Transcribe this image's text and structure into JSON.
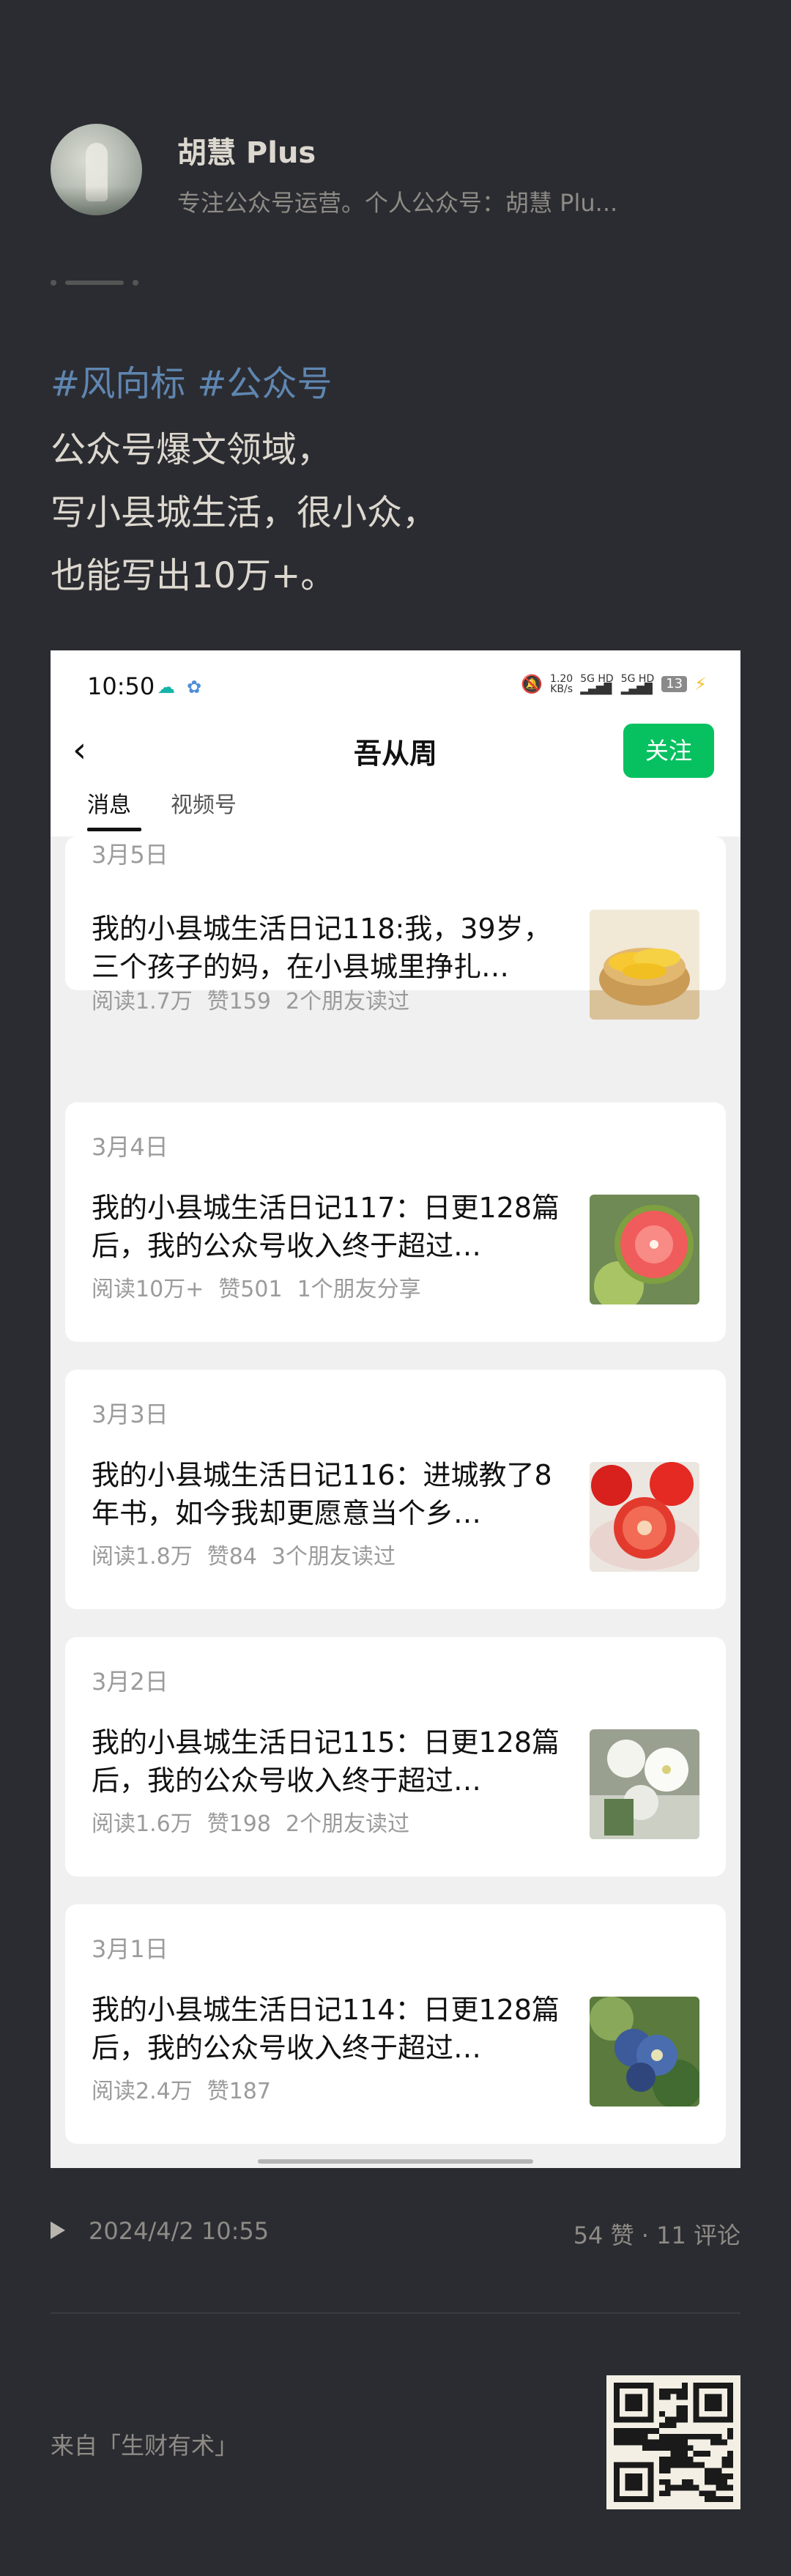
{
  "author": {
    "name": "胡慧 Plus",
    "description": "专注公众号运营。个人公众号：胡慧 Plu..."
  },
  "post": {
    "tags": [
      "#风向标",
      "#公众号"
    ],
    "lines": [
      "公众号爆文领域，",
      "写小县城生活，很小众，",
      "也能写出10万+。"
    ]
  },
  "screenshot": {
    "statusbar": {
      "time": "10:50",
      "net_speed_value": "1.20",
      "net_speed_unit": "KB/s",
      "sim1": "5G HD",
      "sim2": "5G HD",
      "battery": "13"
    },
    "nav": {
      "title": "吾从周",
      "follow_label": "关注"
    },
    "tabs": [
      "消息",
      "视频号"
    ],
    "articles": [
      {
        "date": "3月5日",
        "title": "我的小县城生活日记118:我，39岁，三个孩子的妈，在小县城里挣扎…",
        "reads": "阅读1.7万",
        "likes": "赞159",
        "friends": "2个朋友读过",
        "thumb": "steamer-corn-image"
      },
      {
        "date": "3月4日",
        "title": "我的小县城生活日记117：日更128篇后，我的公众号收入终于超过…",
        "reads": "阅读10万+",
        "likes": "赞501",
        "friends": "1个朋友分享",
        "thumb": "guava-image"
      },
      {
        "date": "3月3日",
        "title": "我的小县城生活日记116：进城教了8年书，如今我却更愿意当个乡…",
        "reads": "阅读1.8万",
        "likes": "赞84",
        "friends": "3个朋友读过",
        "thumb": "tomatoes-image"
      },
      {
        "date": "3月2日",
        "title": "我的小县城生活日记115：日更128篇后，我的公众号收入终于超过…",
        "reads": "阅读1.6万",
        "likes": "赞198",
        "friends": "2个朋友读过",
        "thumb": "white-flowers-image"
      },
      {
        "date": "3月1日",
        "title": "我的小县城生活日记114：日更128篇后，我的公众号收入终于超过…",
        "reads": "阅读2.4万",
        "likes": "赞187",
        "friends": "",
        "thumb": "blueberries-image"
      }
    ]
  },
  "footer": {
    "datetime": "2024/4/2 10:55",
    "stats": "54 赞 · 11 评论",
    "source": "来自「生财有术」"
  },
  "colors": {
    "background": "#2b2c31",
    "tag": "#5f86b1",
    "follow": "#07c160"
  }
}
